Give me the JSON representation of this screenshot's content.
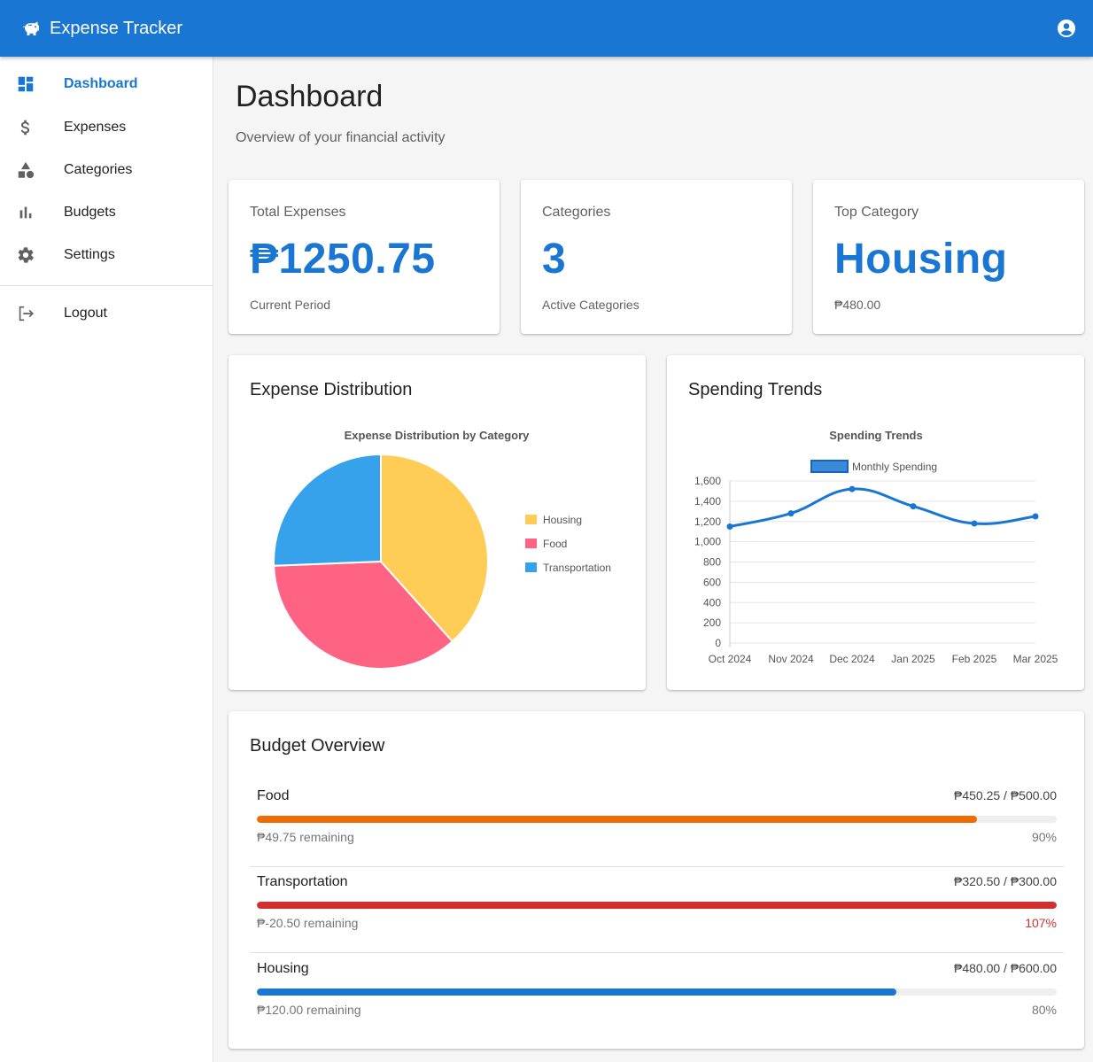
{
  "app": {
    "title": "Expense Tracker"
  },
  "sidebar": {
    "items": [
      {
        "label": "Dashboard",
        "icon": "dashboard-icon",
        "active": true
      },
      {
        "label": "Expenses",
        "icon": "dollar-icon",
        "active": false
      },
      {
        "label": "Categories",
        "icon": "category-shapes-icon",
        "active": false
      },
      {
        "label": "Budgets",
        "icon": "bar-chart-icon",
        "active": false
      },
      {
        "label": "Settings",
        "icon": "gear-icon",
        "active": false
      }
    ],
    "logout": {
      "label": "Logout",
      "icon": "logout-icon"
    }
  },
  "page": {
    "title": "Dashboard",
    "subtitle": "Overview of your financial activity"
  },
  "stats": [
    {
      "label": "Total Expenses",
      "value": "₱1250.75",
      "foot": "Current Period"
    },
    {
      "label": "Categories",
      "value": "3",
      "foot": "Active Categories"
    },
    {
      "label": "Top Category",
      "value": "Housing",
      "foot": "₱480.00"
    }
  ],
  "distribution": {
    "card_title": "Expense Distribution"
  },
  "trends": {
    "card_title": "Spending Trends"
  },
  "chart_data": [
    {
      "type": "pie",
      "title": "Expense Distribution by Category",
      "legend_position": "right",
      "labels": [
        "Housing",
        "Food",
        "Transportation"
      ],
      "values": [
        480.0,
        450.25,
        320.5
      ],
      "colors": [
        "#ffcd56",
        "#ff6384",
        "#36a2eb"
      ]
    },
    {
      "type": "line",
      "title": "Spending Trends",
      "legend_position": "top",
      "x": [
        "Oct 2024",
        "Nov 2024",
        "Dec 2024",
        "Jan 2025",
        "Feb 2025",
        "Mar 2025"
      ],
      "series": [
        {
          "name": "Monthly Spending",
          "values": [
            1150,
            1280,
            1520,
            1350,
            1180,
            1250
          ],
          "color": "#1976d2"
        }
      ],
      "ylim": [
        0,
        1600
      ],
      "yticks": [
        "0",
        "200",
        "400",
        "600",
        "800",
        "1,000",
        "1,200",
        "1,400",
        "1,600"
      ],
      "grid": true
    }
  ],
  "budget": {
    "title": "Budget Overview",
    "rows": [
      {
        "name": "Food",
        "amount": "₱450.25 / ₱500.00",
        "remaining": "₱49.75 remaining",
        "percent_label": "90%",
        "fill_fraction": 0.9,
        "color": "#ef6c00",
        "percent_color": "#757575"
      },
      {
        "name": "Transportation",
        "amount": "₱320.50 / ₱300.00",
        "remaining": "₱-20.50 remaining",
        "percent_label": "107%",
        "fill_fraction": 1.0,
        "color": "#d32f2f",
        "percent_color": "#d32f2f"
      },
      {
        "name": "Housing",
        "amount": "₱480.00 / ₱600.00",
        "remaining": "₱120.00 remaining",
        "percent_label": "80%",
        "fill_fraction": 0.8,
        "color": "#1976d2",
        "percent_color": "#757575"
      }
    ]
  },
  "colors": {
    "primary": "#1976d2",
    "background": "#f5f5f5"
  }
}
